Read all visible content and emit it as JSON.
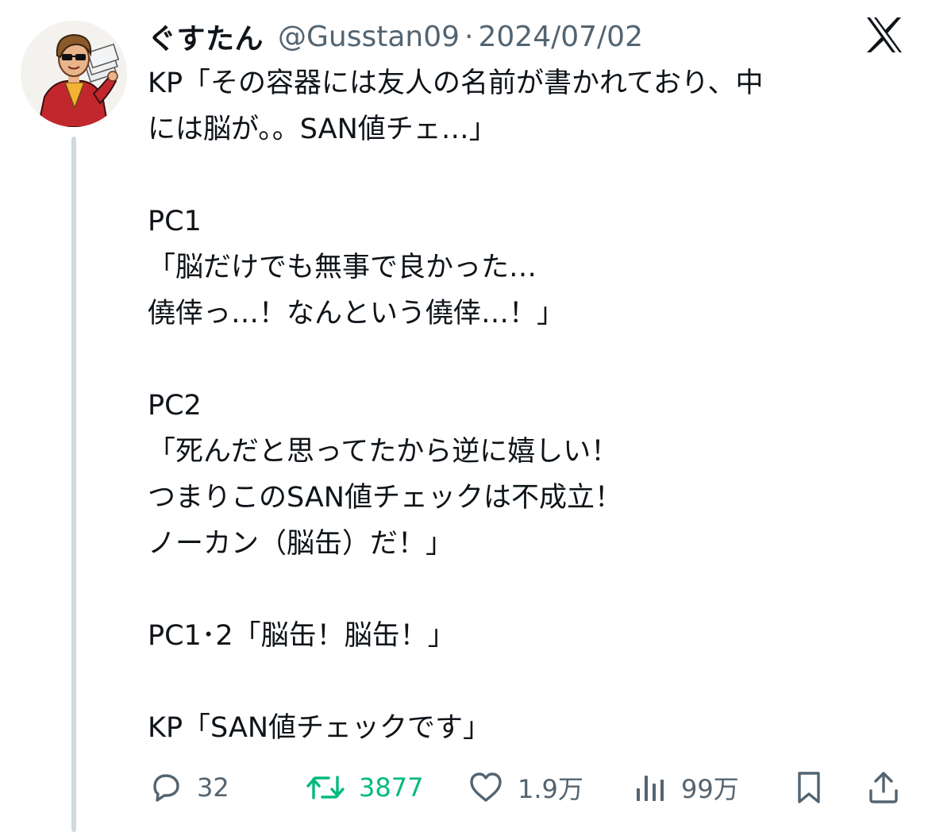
{
  "tweet": {
    "display_name": "ぐすたん",
    "handle": "@Gusstan09",
    "separator": "·",
    "date": "2024/07/02",
    "body_lines": [
      "KP「その容器には友人の名前が書かれており、中",
      "には脳が。。SAN値チェ…」",
      "",
      "PC1",
      "「脳だけでも無事で良かった…",
      "僥倖っ…！なんという僥倖…！」",
      "",
      "PC2",
      "「死んだと思ってたから逆に嬉しい！",
      "つまりこのSAN値チェックは不成立！",
      "ノーカン（脳缶）だ！」",
      "",
      "PC1･2「脳缶！脳缶！」",
      "",
      "KP「SAN値チェックです」"
    ]
  },
  "actions": {
    "reply_count": "32",
    "retweet_count": "3877",
    "like_count": "1.9万",
    "views_count": "99万"
  },
  "icons": {
    "logo": "x-logo-icon",
    "reply": "reply-icon",
    "retweet": "retweet-icon",
    "like": "heart-icon",
    "views": "views-chart-icon",
    "bookmark": "bookmark-icon",
    "share": "share-icon"
  },
  "colors": {
    "text": "#0f1419",
    "secondary": "#536471",
    "retweet_active": "#00ba7c",
    "thread_line": "#cfd9de"
  }
}
